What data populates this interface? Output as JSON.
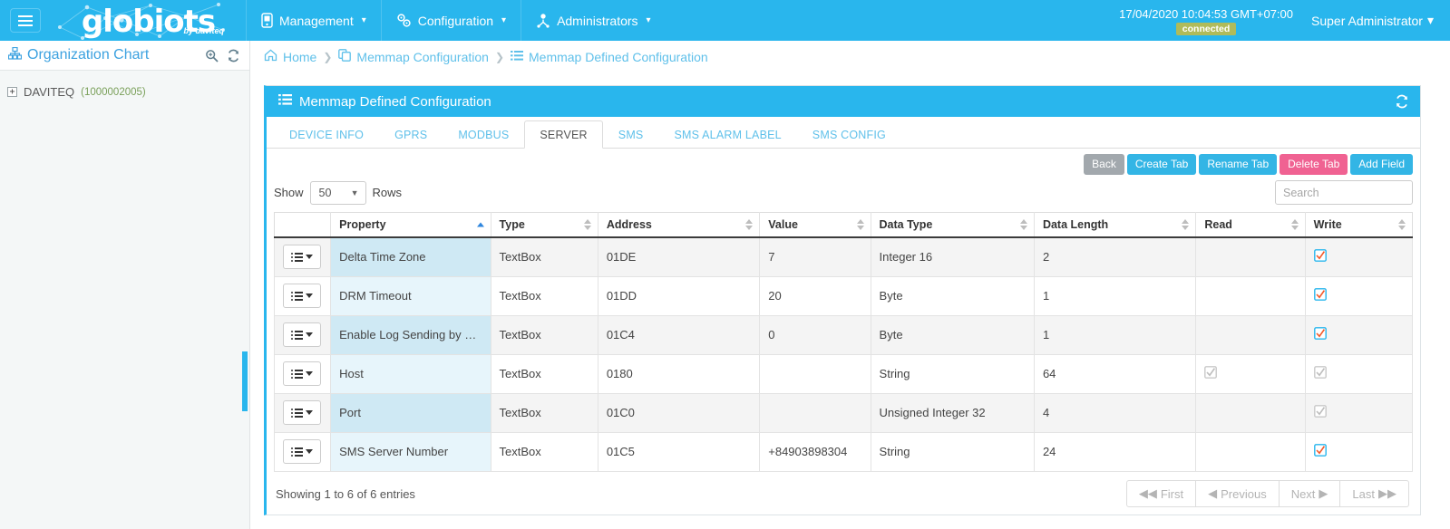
{
  "navbar": {
    "toggle_icon": "hamburger-icon",
    "brand": "globiots",
    "brand_sub": "by daviteq",
    "menu": [
      {
        "label": "Management",
        "icon": "device-icon"
      },
      {
        "label": "Configuration",
        "icon": "gears-icon"
      },
      {
        "label": "Administrators",
        "icon": "users-icon"
      }
    ],
    "datetime": "17/04/2020 10:04:53 GMT+07:00",
    "connection_status": "connected",
    "user": "Super Administrator"
  },
  "sidebar": {
    "title": "Organization Chart",
    "title_icon": "sitemap-icon",
    "actions": [
      {
        "name": "search-icon"
      },
      {
        "name": "refresh-icon"
      }
    ],
    "tree": [
      {
        "expander": "+",
        "label": "DAVITEQ",
        "code": "(1000002005)"
      }
    ]
  },
  "breadcrumb": [
    {
      "label": "Home",
      "icon": "home-icon"
    },
    {
      "label": "Memmap Configuration",
      "icon": "copy-icon"
    },
    {
      "label": "Memmap Defined Configuration",
      "icon": "list-icon"
    }
  ],
  "panel": {
    "title": "Memmap Defined Configuration",
    "title_icon": "list-icon",
    "refresh_icon": "refresh-icon"
  },
  "tabs": [
    {
      "label": "DEVICE INFO",
      "active": false
    },
    {
      "label": "GPRS",
      "active": false
    },
    {
      "label": "MODBUS",
      "active": false
    },
    {
      "label": "SERVER",
      "active": true
    },
    {
      "label": "SMS",
      "active": false
    },
    {
      "label": "SMS ALARM LABEL",
      "active": false
    },
    {
      "label": "SMS CONFIG",
      "active": false
    }
  ],
  "toolbar": {
    "back_label": "Back",
    "create_tab_label": "Create Tab",
    "rename_tab_label": "Rename Tab",
    "delete_tab_label": "Delete Tab",
    "add_field_label": "Add Field"
  },
  "table_controls": {
    "show_label": "Show",
    "rows_label": "Rows",
    "rows_value": "50",
    "search_placeholder": "Search"
  },
  "table": {
    "columns": [
      {
        "label": "",
        "sort": "none"
      },
      {
        "label": "Property",
        "sort": "asc"
      },
      {
        "label": "Type",
        "sort": "both"
      },
      {
        "label": "Address",
        "sort": "both"
      },
      {
        "label": "Value",
        "sort": "both"
      },
      {
        "label": "Data Type",
        "sort": "both"
      },
      {
        "label": "Data Length",
        "sort": "both"
      },
      {
        "label": "Read",
        "sort": "both"
      },
      {
        "label": "Write",
        "sort": "both"
      }
    ],
    "rows": [
      {
        "property": "Delta Time Zone",
        "type": "TextBox",
        "address": "01DE",
        "value": "7",
        "data_type": "Integer 16",
        "data_length": "2",
        "read": "none",
        "write": "checked"
      },
      {
        "property": "DRM Timeout",
        "type": "TextBox",
        "address": "01DD",
        "value": "20",
        "data_type": "Byte",
        "data_length": "1",
        "read": "none",
        "write": "checked"
      },
      {
        "property": "Enable Log Sending by SMS",
        "type": "TextBox",
        "address": "01C4",
        "value": "0",
        "data_type": "Byte",
        "data_length": "1",
        "read": "none",
        "write": "checked"
      },
      {
        "property": "Host",
        "type": "TextBox",
        "address": "0180",
        "value": "",
        "data_type": "String",
        "data_length": "64",
        "read": "disabled",
        "write": "disabled"
      },
      {
        "property": "Port",
        "type": "TextBox",
        "address": "01C0",
        "value": "",
        "data_type": "Unsigned Integer 32",
        "data_length": "4",
        "read": "none",
        "write": "disabled"
      },
      {
        "property": "SMS Server Number",
        "type": "TextBox",
        "address": "01C5",
        "value": "+84903898304",
        "data_type": "String",
        "data_length": "24",
        "read": "none",
        "write": "checked"
      }
    ]
  },
  "footer": {
    "entries_info": "Showing 1 to 6 of 6 entries",
    "pager": [
      {
        "label": "First",
        "icon": "double-left-icon",
        "icon_pos": "left"
      },
      {
        "label": "Previous",
        "icon": "left-icon",
        "icon_pos": "left"
      },
      {
        "label": "Next",
        "icon": "right-icon",
        "icon_pos": "right"
      },
      {
        "label": "Last",
        "icon": "double-right-icon",
        "icon_pos": "right"
      }
    ]
  },
  "colors": {
    "brand_blue": "#29b6ed",
    "danger_pink": "#f06292",
    "badge_olive": "#b0bb5a",
    "prop_cell_blue": "#cfe9f4",
    "check_orange": "#f4592a"
  }
}
